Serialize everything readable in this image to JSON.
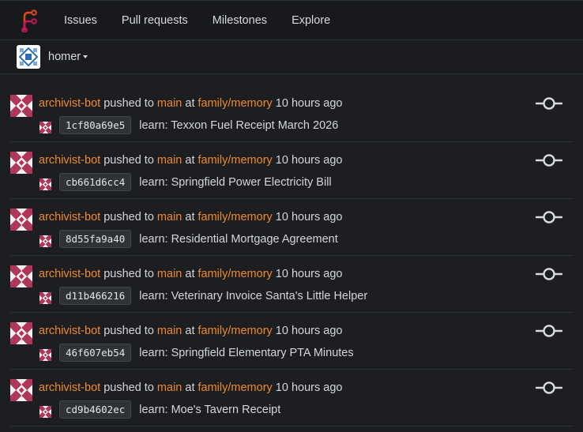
{
  "nav": {
    "items": [
      "Issues",
      "Pull requests",
      "Milestones",
      "Explore"
    ]
  },
  "context": {
    "name": "homer"
  },
  "feed": [
    {
      "actor": "archivist-bot",
      "action": " pushed to ",
      "branch": "main",
      "at": " at ",
      "repo": "family/memory",
      "time": " 10 hours ago",
      "sha": "1cf80a69e5",
      "message": "learn: Texxon Fuel Receipt March 2026"
    },
    {
      "actor": "archivist-bot",
      "action": " pushed to ",
      "branch": "main",
      "at": " at ",
      "repo": "family/memory",
      "time": " 10 hours ago",
      "sha": "cb661d6cc4",
      "message": "learn: Springfield Power Electricity Bill"
    },
    {
      "actor": "archivist-bot",
      "action": " pushed to ",
      "branch": "main",
      "at": " at ",
      "repo": "family/memory",
      "time": " 10 hours ago",
      "sha": "8d55fa9a40",
      "message": "learn: Residential Mortgage Agreement"
    },
    {
      "actor": "archivist-bot",
      "action": " pushed to ",
      "branch": "main",
      "at": " at ",
      "repo": "family/memory",
      "time": " 10 hours ago",
      "sha": "d11b466216",
      "message": "learn: Veterinary Invoice Santa's Little Helper"
    },
    {
      "actor": "archivist-bot",
      "action": " pushed to ",
      "branch": "main",
      "at": " at ",
      "repo": "family/memory",
      "time": " 10 hours ago",
      "sha": "46f607eb54",
      "message": "learn: Springfield Elementary PTA Minutes"
    },
    {
      "actor": "archivist-bot",
      "action": " pushed to ",
      "branch": "main",
      "at": " at ",
      "repo": "family/memory",
      "time": " 10 hours ago",
      "sha": "cd9b4602ec",
      "message": "learn: Moe's Tavern Receipt"
    }
  ],
  "colors": {
    "accent": "#ee8a2b",
    "avatar_pattern": "#b0365a",
    "logo": "#e0481d"
  },
  "icons": {
    "logo": "forgejo-logo-icon",
    "org": "org-avatar-icon",
    "commit": "git-commit-icon",
    "caret": "caret-down-icon"
  }
}
